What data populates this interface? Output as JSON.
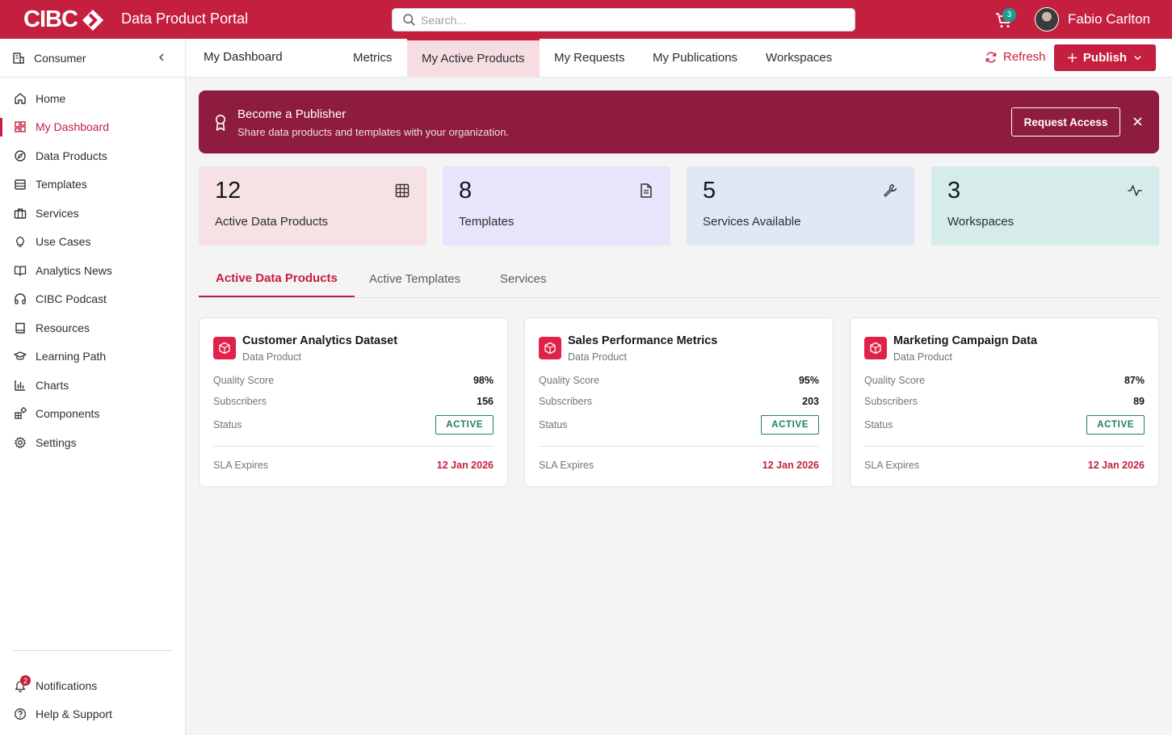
{
  "header": {
    "logo_text": "CIBC",
    "app_title": "Data Product Portal",
    "search_placeholder": "Search...",
    "cart_count": "3",
    "user_name": "Fabio Carlton"
  },
  "sidebar": {
    "persona": "Consumer",
    "items": [
      {
        "label": "Home",
        "icon": "home-icon"
      },
      {
        "label": "My Dashboard",
        "icon": "grid-icon",
        "active": true
      },
      {
        "label": "Data Products",
        "icon": "compass-icon"
      },
      {
        "label": "Templates",
        "icon": "cabinet-icon"
      },
      {
        "label": "Services",
        "icon": "briefcase-icon"
      },
      {
        "label": "Use Cases",
        "icon": "lightbulb-icon"
      },
      {
        "label": "Analytics News",
        "icon": "book-open-icon"
      },
      {
        "label": "CIBC Podcast",
        "icon": "headphones-icon"
      },
      {
        "label": "Resources",
        "icon": "book-icon"
      },
      {
        "label": "Learning Path",
        "icon": "graduation-cap-icon"
      },
      {
        "label": "Charts",
        "icon": "bar-chart-icon"
      },
      {
        "label": "Components",
        "icon": "components-icon"
      },
      {
        "label": "Settings",
        "icon": "gear-icon"
      }
    ],
    "bottom": {
      "notifications": "Notifications",
      "notifications_count": "2",
      "help": "Help & Support"
    }
  },
  "subnav": {
    "title": "My Dashboard",
    "tabs": [
      "Metrics",
      "My Active Products",
      "My Requests",
      "My Publications",
      "Workspaces"
    ],
    "active_tab": "My Active Products",
    "refresh": "Refresh",
    "publish": "Publish"
  },
  "banner": {
    "title": "Become a Publisher",
    "subtitle": "Share data products and templates with your organization.",
    "button": "Request Access"
  },
  "stats": [
    {
      "value": "12",
      "label": "Active Data Products",
      "icon": "table-icon",
      "color": "#f6e1e4"
    },
    {
      "value": "8",
      "label": "Templates",
      "icon": "document-icon",
      "color": "#e8e4fb"
    },
    {
      "value": "5",
      "label": "Services Available",
      "icon": "wrench-icon",
      "color": "#dfe9f6"
    },
    {
      "value": "3",
      "label": "Workspaces",
      "icon": "activity-icon",
      "color": "#d5eceb"
    }
  ],
  "tabs": {
    "items": [
      "Active Data Products",
      "Active Templates",
      "Services"
    ],
    "active": "Active Data Products"
  },
  "cards": [
    {
      "title": "Customer Analytics Dataset",
      "type": "Data Product",
      "quality_label": "Quality Score",
      "quality": "98%",
      "subs_label": "Subscribers",
      "subs": "156",
      "status_label": "Status",
      "status": "ACTIVE",
      "sla_label": "SLA Expires",
      "sla": "12 Jan 2026"
    },
    {
      "title": "Sales Performance Metrics",
      "type": "Data Product",
      "quality_label": "Quality Score",
      "quality": "95%",
      "subs_label": "Subscribers",
      "subs": "203",
      "status_label": "Status",
      "status": "ACTIVE",
      "sla_label": "SLA Expires",
      "sla": "12 Jan 2026"
    },
    {
      "title": "Marketing Campaign Data",
      "type": "Data Product",
      "quality_label": "Quality Score",
      "quality": "87%",
      "subs_label": "Subscribers",
      "subs": "89",
      "status_label": "Status",
      "status": "ACTIVE",
      "sla_label": "SLA Expires",
      "sla": "12 Jan 2026"
    }
  ],
  "colors": {
    "brand": "#c41f3e",
    "banner": "#8d1c3e",
    "status_active": "#1c7d6a"
  }
}
